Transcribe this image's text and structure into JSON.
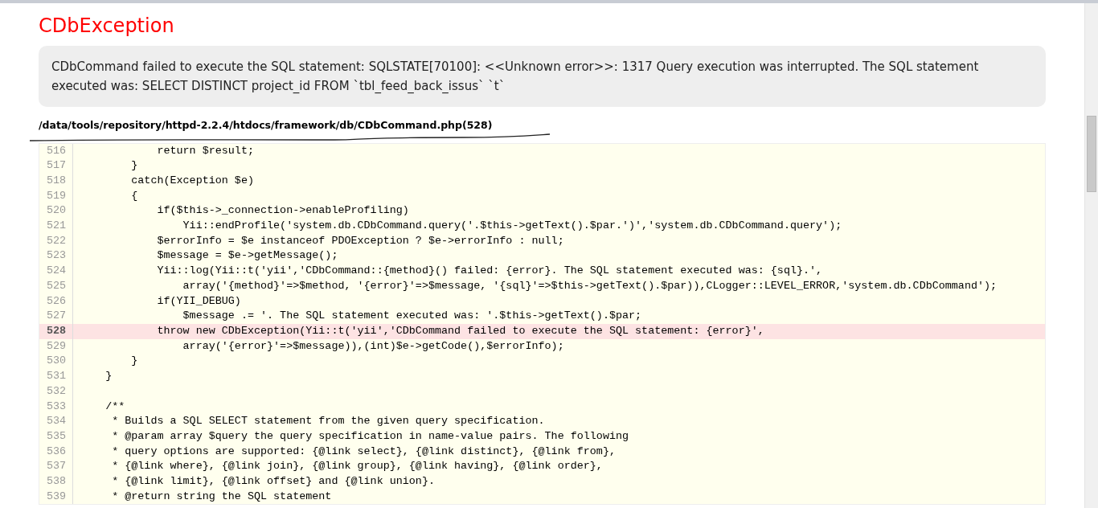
{
  "title": "CDbException",
  "message": "CDbCommand failed to execute the SQL statement: SQLSTATE[70100]: <<Unknown error>>: 1317 Query execution was interrupted. The SQL statement executed was: SELECT DISTINCT project_id FROM `tbl_feed_back_issus` `t`",
  "file_path": "/data/tools/repository/httpd-2.2.4/htdocs/framework/db/CDbCommand.php(528)",
  "source_lines": [
    {
      "number": "516",
      "code": "            return $result;",
      "highlighted": false
    },
    {
      "number": "517",
      "code": "        }",
      "highlighted": false
    },
    {
      "number": "518",
      "code": "        catch(Exception $e)",
      "highlighted": false
    },
    {
      "number": "519",
      "code": "        {",
      "highlighted": false
    },
    {
      "number": "520",
      "code": "            if($this->_connection->enableProfiling)",
      "highlighted": false
    },
    {
      "number": "521",
      "code": "                Yii::endProfile('system.db.CDbCommand.query('.$this->getText().$par.')','system.db.CDbCommand.query');",
      "highlighted": false
    },
    {
      "number": "522",
      "code": "            $errorInfo = $e instanceof PDOException ? $e->errorInfo : null;",
      "highlighted": false
    },
    {
      "number": "523",
      "code": "            $message = $e->getMessage();",
      "highlighted": false
    },
    {
      "number": "524",
      "code": "            Yii::log(Yii::t('yii','CDbCommand::{method}() failed: {error}. The SQL statement executed was: {sql}.',",
      "highlighted": false
    },
    {
      "number": "525",
      "code": "                array('{method}'=>$method, '{error}'=>$message, '{sql}'=>$this->getText().$par)),CLogger::LEVEL_ERROR,'system.db.CDbCommand');",
      "highlighted": false
    },
    {
      "number": "526",
      "code": "            if(YII_DEBUG)",
      "highlighted": false
    },
    {
      "number": "527",
      "code": "                $message .= '. The SQL statement executed was: '.$this->getText().$par;",
      "highlighted": false
    },
    {
      "number": "528",
      "code": "            throw new CDbException(Yii::t('yii','CDbCommand failed to execute the SQL statement: {error}',",
      "highlighted": true
    },
    {
      "number": "529",
      "code": "                array('{error}'=>$message)),(int)$e->getCode(),$errorInfo);",
      "highlighted": false
    },
    {
      "number": "530",
      "code": "        }",
      "highlighted": false
    },
    {
      "number": "531",
      "code": "    }",
      "highlighted": false
    },
    {
      "number": "532",
      "highlighted": false
    },
    {
      "number": "533",
      "code": "    /**",
      "highlighted": false
    },
    {
      "number": "534",
      "code": "     * Builds a SQL SELECT statement from the given query specification.",
      "highlighted": false
    },
    {
      "number": "535",
      "code": "     * @param array $query the query specification in name-value pairs. The following",
      "highlighted": false
    },
    {
      "number": "536",
      "code": "     * query options are supported: {@link select}, {@link distinct}, {@link from},",
      "highlighted": false
    },
    {
      "number": "537",
      "code": "     * {@link where}, {@link join}, {@link group}, {@link having}, {@link order},",
      "highlighted": false
    },
    {
      "number": "538",
      "code": "     * {@link limit}, {@link offset} and {@link union}.",
      "highlighted": false
    },
    {
      "number": "539",
      "code": "     * @return string the SQL statement",
      "highlighted": false
    }
  ]
}
